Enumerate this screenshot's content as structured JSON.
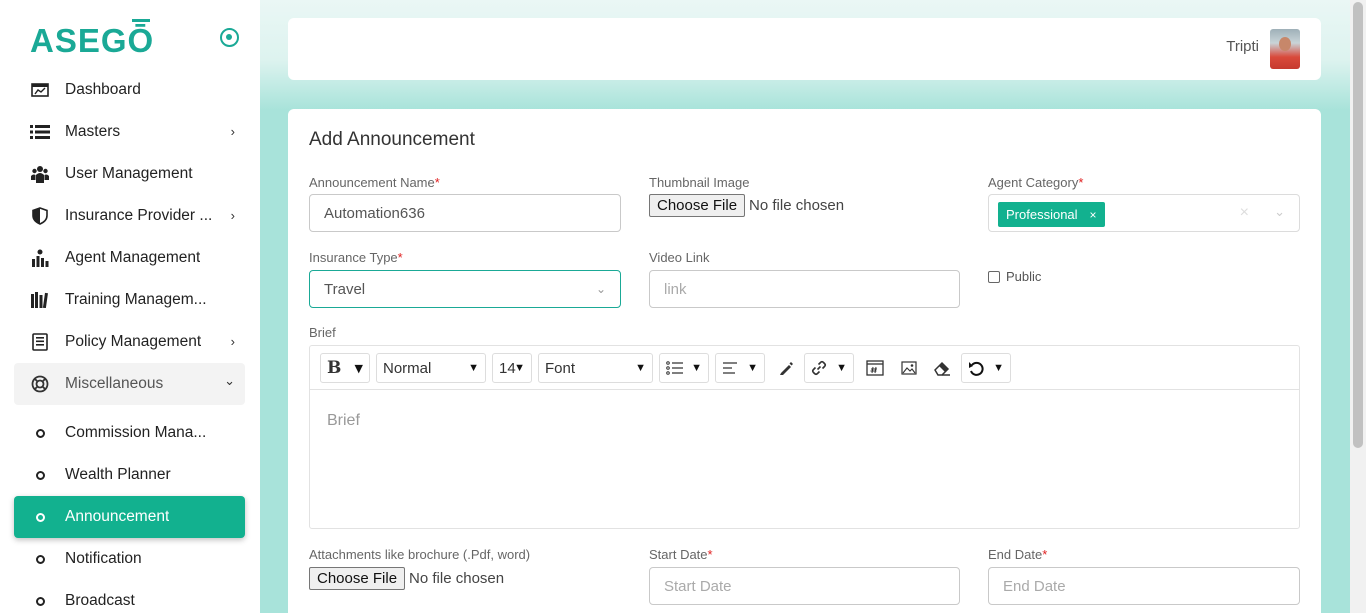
{
  "brand": {
    "logo_text_a": "ASEG",
    "logo_text_b": "Ō"
  },
  "sidebar": {
    "items": [
      {
        "label": "Dashboard",
        "icon": "dashboard-icon"
      },
      {
        "label": "Masters",
        "icon": "list-icon",
        "chevron": "›"
      },
      {
        "label": "User Management",
        "icon": "users-icon"
      },
      {
        "label": "Insurance Provider ...",
        "icon": "shield-icon",
        "chevron": "›"
      },
      {
        "label": "Agent Management",
        "icon": "agents-icon"
      },
      {
        "label": "Training Managem...",
        "icon": "books-icon"
      },
      {
        "label": "Policy Management",
        "icon": "document-icon",
        "chevron": "›"
      },
      {
        "label": "Miscellaneous",
        "icon": "lifebuoy-icon",
        "chevron": "⌄"
      }
    ],
    "sub_items": [
      {
        "label": "Commission Mana..."
      },
      {
        "label": "Wealth Planner"
      },
      {
        "label": "Announcement"
      },
      {
        "label": "Notification"
      },
      {
        "label": "Broadcast"
      }
    ]
  },
  "header": {
    "username": "Tripti"
  },
  "form": {
    "title": "Add Announcement",
    "announcement_name": {
      "label": "Announcement Name",
      "value": "Automation636"
    },
    "thumbnail": {
      "label": "Thumbnail Image",
      "button": "Choose File",
      "status": "No file chosen"
    },
    "agent_category": {
      "label": "Agent Category",
      "chip": "Professional",
      "chip_remove": "×",
      "clear": "×",
      "chevron": "⌄"
    },
    "insurance_type": {
      "label": "Insurance Type",
      "value": "Travel",
      "chevron": "⌄"
    },
    "video_link": {
      "label": "Video Link",
      "placeholder": "link"
    },
    "public": {
      "label": "Public",
      "checked": false
    },
    "brief": {
      "label": "Brief",
      "placeholder": "Brief",
      "toolbar": {
        "bold": "B",
        "style": "Normal",
        "size": "14",
        "font": "Font",
        "caret": "▼"
      }
    },
    "attachments": {
      "label": "Attachments like brochure (.Pdf, word)",
      "button": "Choose File",
      "status": "No file chosen"
    },
    "start_date": {
      "label": "Start Date",
      "placeholder": "Start Date"
    },
    "end_date": {
      "label": "End Date",
      "placeholder": "End Date"
    },
    "required_mark": "*"
  },
  "colors": {
    "accent": "#12b18f",
    "logo": "#1aa996",
    "required": "#e02020"
  }
}
